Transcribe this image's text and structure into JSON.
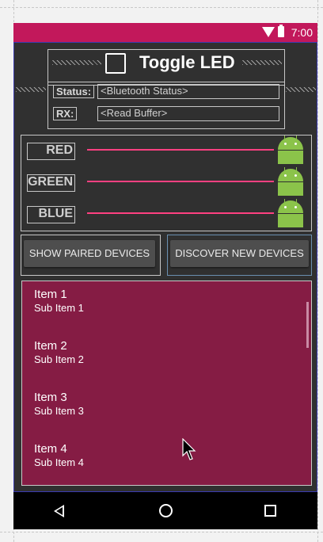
{
  "status_bar": {
    "time": "7:00",
    "wifi_icon": "wifi-icon",
    "battery_icon": "battery-icon",
    "background": "#c2185b"
  },
  "header": {
    "toggle_label": "Toggle LED"
  },
  "status_row": {
    "label": "Status:",
    "value": "<Bluetooth Status>"
  },
  "rx_row": {
    "label": "RX:",
    "value": "<Read Buffer>"
  },
  "sliders": [
    {
      "label": "RED",
      "icon": "android-icon"
    },
    {
      "label": "GREEN",
      "icon": "android-icon"
    },
    {
      "label": "BLUE",
      "icon": "android-icon"
    }
  ],
  "buttons": {
    "show_paired": "SHOW PAIRED DEVICES",
    "discover_new": "DISCOVER NEW DEVICES"
  },
  "list": {
    "background": "#851c44",
    "items": [
      {
        "title": "Item 1",
        "subtitle": "Sub Item 1"
      },
      {
        "title": "Item 2",
        "subtitle": "Sub Item 2"
      },
      {
        "title": "Item 3",
        "subtitle": "Sub Item 3"
      },
      {
        "title": "Item 4",
        "subtitle": "Sub Item 4"
      }
    ]
  },
  "nav_bar": {
    "back_icon": "back-triangle-icon",
    "home_icon": "home-circle-icon",
    "recents_icon": "recents-square-icon"
  },
  "accent": "#ff4081"
}
